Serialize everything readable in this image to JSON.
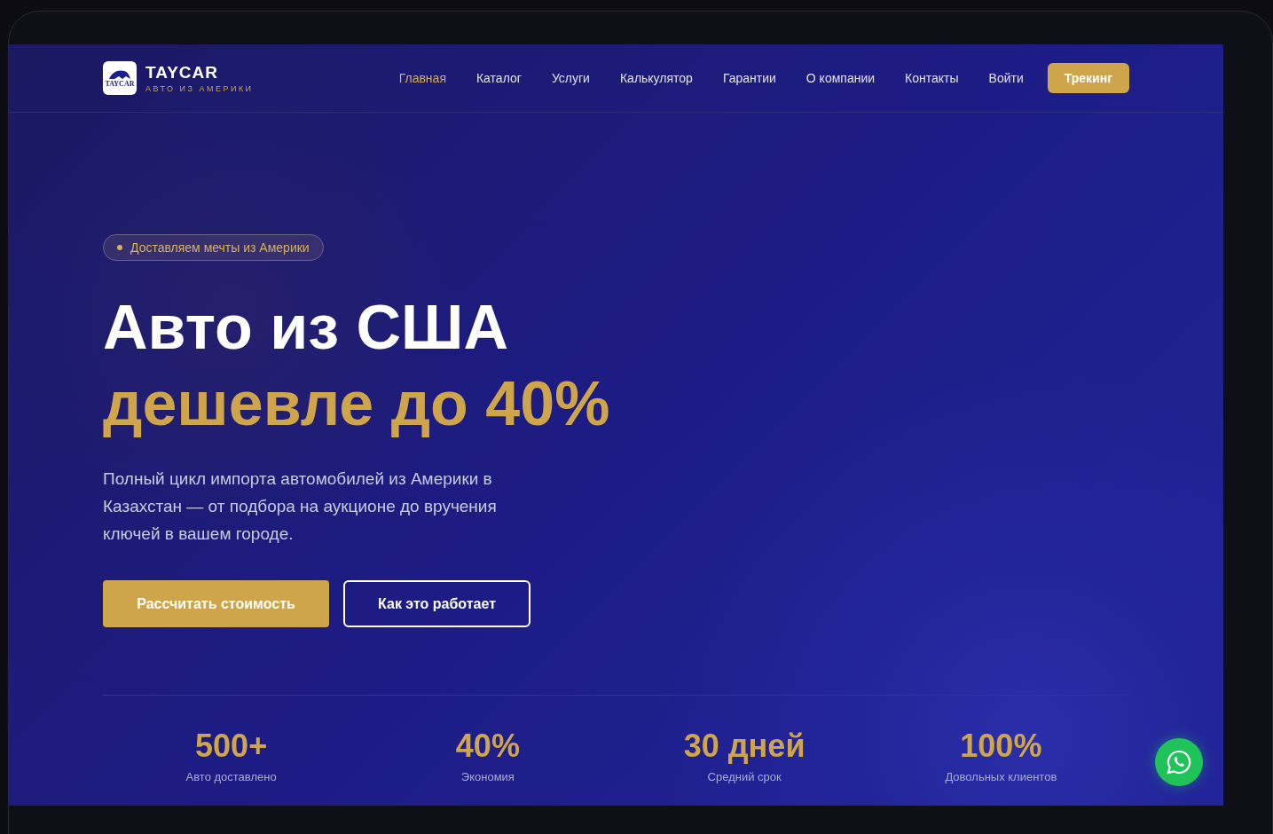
{
  "header": {
    "logo_mark": "TAYCAR",
    "brand": "TAYCAR",
    "tagline": "АВТО ИЗ АМЕРИКИ",
    "nav": [
      {
        "label": "Главная",
        "selected": true
      },
      {
        "label": "Каталог",
        "selected": false
      },
      {
        "label": "Услуги",
        "selected": false
      },
      {
        "label": "Калькулятор",
        "selected": false
      },
      {
        "label": "Гарантии",
        "selected": false
      },
      {
        "label": "О компании",
        "selected": false
      },
      {
        "label": "Контакты",
        "selected": false
      },
      {
        "label": "Войти",
        "selected": false
      }
    ],
    "cta": "Трекинг"
  },
  "hero": {
    "badge": "Доставляем мечты из Америки",
    "title_line1": "Авто из США",
    "title_line2": "дешевле до 40%",
    "description": "Полный цикл импорта автомобилей из Америки в Казахстан — от подбора на аукционе до вручения ключей в вашем городе.",
    "primary_button": "Рассчитать стоимость",
    "secondary_button": "Как это работает"
  },
  "stats": [
    {
      "value": "500+",
      "label": "Авто доставлено"
    },
    {
      "value": "40%",
      "label": "Экономия"
    },
    {
      "value": "30 дней",
      "label": "Средний срок"
    },
    {
      "value": "100%",
      "label": "Довольных клиентов"
    }
  ]
}
